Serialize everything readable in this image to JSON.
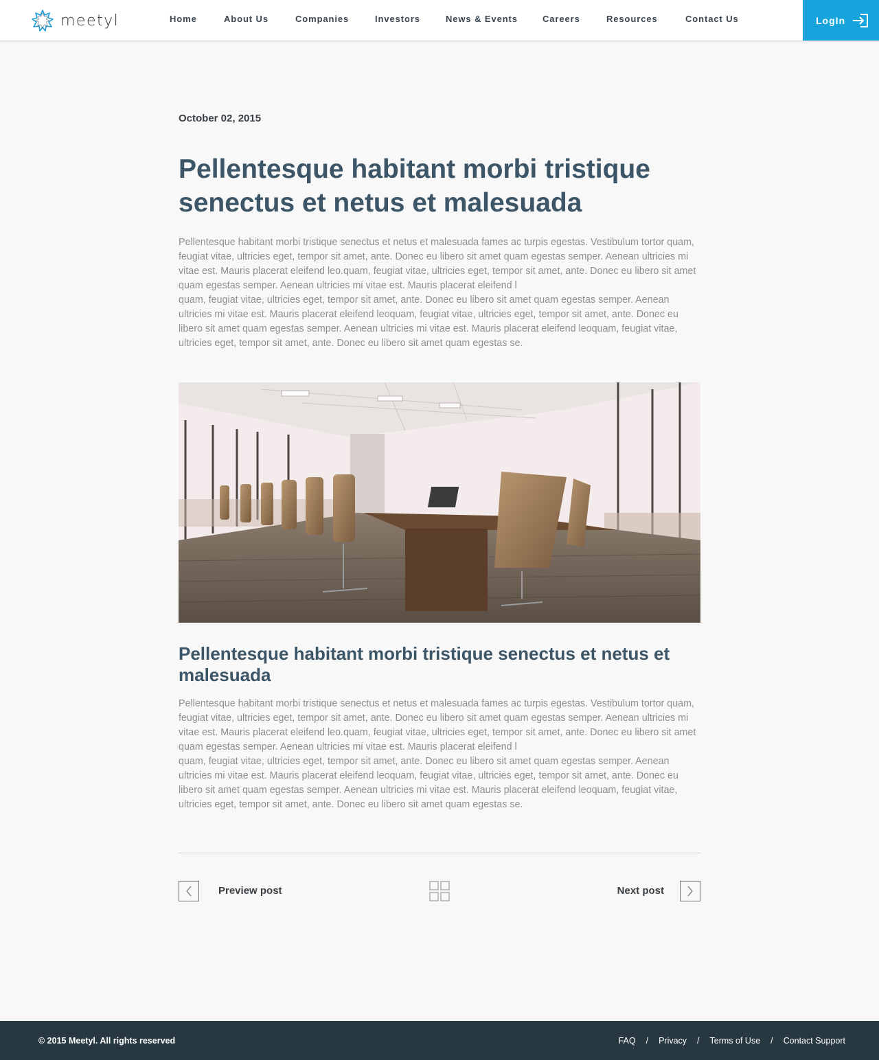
{
  "brand": {
    "name": "meetyl",
    "logo_icon": "starburst-logo-icon",
    "accent_color": "#17a3dc"
  },
  "nav": {
    "items": [
      {
        "label": "Home"
      },
      {
        "label": "About Us"
      },
      {
        "label": "Companies"
      },
      {
        "label": "Investors"
      },
      {
        "label": "News & Events"
      },
      {
        "label": "Careers"
      },
      {
        "label": "Resources"
      },
      {
        "label": "Contact Us"
      }
    ],
    "login_label": "LogIn",
    "login_icon": "login-arrow-icon"
  },
  "article": {
    "date": "October 02, 2015",
    "title": "Pellentesque habitant morbi tristique senectus et netus et malesuada",
    "intro": [
      "Pellentesque habitant morbi tristique senectus et netus et malesuada fames ac turpis egestas. Vestibulum tortor quam, feugiat vitae, ultricies eget, tempor sit amet, ante. Donec eu libero sit amet quam egestas semper. Aenean ultricies mi vitae est. Mauris placerat eleifend leo.quam, feugiat vitae, ultricies eget, tempor sit amet, ante. Donec eu libero sit amet quam egestas semper. Aenean ultricies mi vitae est. Mauris placerat eleifend l",
      "quam, feugiat vitae, ultricies eget, tempor sit amet, ante. Donec eu libero sit amet quam egestas semper. Aenean ultricies mi vitae est. Mauris placerat eleifend leoquam, feugiat vitae, ultricies eget, tempor sit amet, ante. Donec eu libero sit amet quam egestas semper. Aenean ultricies mi vitae est. Mauris placerat eleifend leoquam, feugiat vitae, ultricies eget, tempor sit amet, ante. Donec eu libero sit amet quam egestas se."
    ],
    "image_subject": "conference-room-photo",
    "subtitle": "Pellentesque habitant morbi tristique senectus et netus et malesuada",
    "body": [
      "Pellentesque habitant morbi tristique senectus et netus et malesuada fames ac turpis egestas. Vestibulum tortor quam, feugiat vitae, ultricies eget, tempor sit amet, ante. Donec eu libero sit amet quam egestas semper. Aenean ultricies mi vitae est. Mauris placerat eleifend leo.quam, feugiat vitae, ultricies eget, tempor sit amet, ante. Donec eu libero sit amet quam egestas semper. Aenean ultricies mi vitae est. Mauris placerat eleifend l",
      "quam, feugiat vitae, ultricies eget, tempor sit amet, ante. Donec eu libero sit amet quam egestas semper. Aenean ultricies mi vitae est. Mauris placerat eleifend leoquam, feugiat vitae, ultricies eget, tempor sit amet, ante. Donec eu libero sit amet quam egestas semper. Aenean ultricies mi vitae est. Mauris placerat eleifend leoquam, feugiat vitae, ultricies eget, tempor sit amet, ante. Donec eu libero sit amet quam egestas se."
    ]
  },
  "pager": {
    "prev_label": "Preview post",
    "next_label": "Next post",
    "prev_icon": "chevron-left-icon",
    "next_icon": "chevron-right-icon",
    "grid_icon": "grid-icon"
  },
  "footer": {
    "copyright": "© 2015 Meetyl. All rights reserved",
    "links": [
      "FAQ",
      "Privacy",
      "Terms of Use",
      "Contact Support"
    ],
    "separator": "/",
    "background": "#283841"
  }
}
